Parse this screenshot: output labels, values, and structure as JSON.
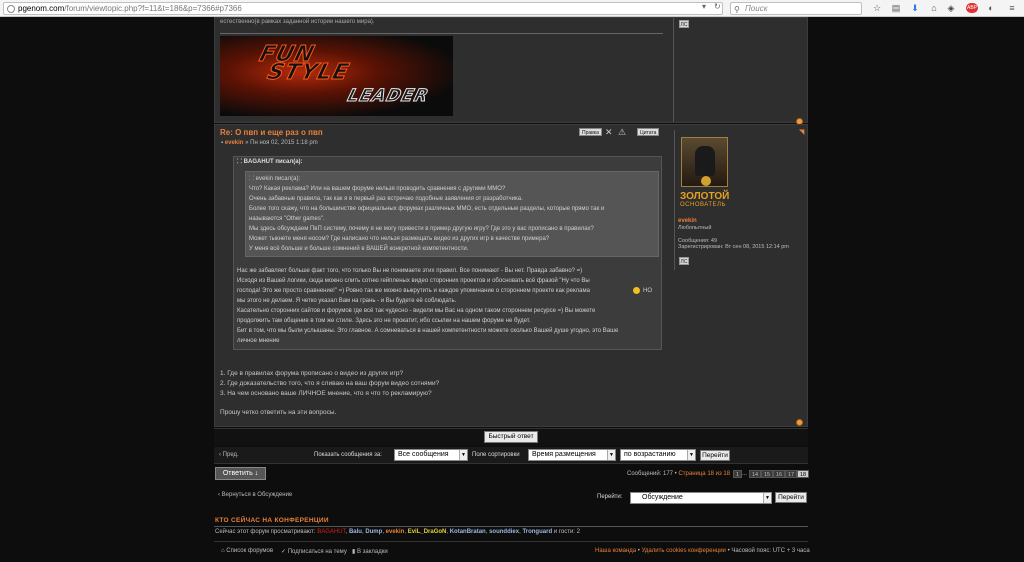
{
  "browser": {
    "url_domain": "pgenom.com",
    "url_path": "/forum/viewtopic.php?f=11&t=186&p=7366#p7366",
    "search_placeholder": "Поиск"
  },
  "prev_post": {
    "text_top": "естественно(в рамках заданной истории нашего мира).",
    "logo_line1": "FUN",
    "logo_line2": "STYLE",
    "logo_line3": "LEADER",
    "ps_label": "ЛС"
  },
  "post": {
    "title": "Re: О пвп и еще раз о пвп",
    "author": "evekin",
    "date": "Пн ноя 02, 2015 1:18 pm",
    "actions": {
      "edit": "Правка",
      "quote": "Цитата"
    },
    "outer_quote_head": "BAGAHUT писал(а):",
    "inner_quote_head": "evekin писал(а):",
    "inner_quote_lines": [
      "Что? Какая реклама? Или на вашем форуме нельзя проводить сравнения с другими ММО?",
      "Очень забавные правила, так как я в первый раз встречаю подобные заявления от разработчика.",
      "Более того скажу, что на большинстве официальных форумах различных ММО, есть отдельные разделы, которые прямо так и",
      "называются \"Other games\".",
      "Мы здесь обсуждаем ПвП систему, почему я не могу привести в пример другую игру? Где это у вас прописано в правилах?",
      "Может тыкнете меня носом? Где написано что нельзя размещать видео из других игр в качестве примера?",
      "У меня всё больше и больше сомнений в ВАШЕЙ конкретной компетентности."
    ],
    "outer_quote_lines": [
      "Нас же забавляет больше факт того, что только Вы не понимаете этих правил. Все понимают - Вы нет. Правда забавно? =)",
      "Исходя из Вашей логики, сюда можно слить сотню гейпленых видео сторонних проектов и обосновать всё фразой \"Ну что Вы",
      "господа! Это же просто сравнение!\" =) Ровно так же можно выкрутить и каждое упоминание о стороннем проекте как реклама",
      "НО",
      "мы этого не делаем. Я четко указал Вам на грань - и Вы будете её соблюдать.",
      "Касательно сторонних сайтов и форумов где всё так чудесно - видели мы Вас на одном таком стороннем ресурсе =) Вы можете",
      "продолжить там общение в том же стиле. Здесь это не прокатит, ибо ссылки на нашем форуме не будет.",
      "Бит в том, что мы были услышаны. Это главное. А сомневаться в нашей компетентности можете сколько Вашей душе угодно, это Ваше",
      "личное мнение"
    ],
    "body_lines": [
      "1. Где в правилах форума прописано о видео из других игр?",
      "2. Где доказательство того, что я сливаю на ваш форум видео сотнями?",
      "3. На чем основано ваше ЛИЧНОЕ мнение, что я что то рекламирую?"
    ],
    "closing": "Прошу четко ответить на эти вопросы."
  },
  "profile": {
    "rank_line1": "ЗОЛОТОЙ",
    "rank_line2": "ОСНОВАТЕЛЬ",
    "name": "evekin",
    "title": "Любопытный",
    "messages": "Сообщения: 49",
    "registered": "Зарегистрирован: Вт сен 08, 2015 12:14 pm",
    "ps_label": "ЛС"
  },
  "quick_reply": {
    "label": "Быстрый ответ"
  },
  "nav": {
    "prev": "Пред.",
    "show_label": "Показать сообщения за:",
    "show_value": "Все сообщения",
    "sort_label": "Поле сортировки",
    "sort_value": "Время размещения",
    "order_value": "по возрастанию",
    "go": "Перейти"
  },
  "pagination": {
    "reply": "Ответить",
    "summary": "Сообщений: 177",
    "page_info": "Страница 18 из 18",
    "pages": [
      "1",
      "...",
      "14",
      "15",
      "16",
      "17",
      "18"
    ]
  },
  "return_link": "Вернуться в Обсуждение",
  "jump": {
    "label": "Перейти:",
    "value": "Обсуждение",
    "go": "Перейти"
  },
  "who": {
    "heading": "КТО СЕЙЧАС НА КОНФЕРЕНЦИИ",
    "prefix": "Сейчас этот форум просматривают:",
    "users": [
      "BAGAHUT",
      "Balu",
      "Dump",
      "evekin",
      "EviL_DraGoN",
      "KotanBratan",
      "sounddiex",
      "Tronguard"
    ],
    "suffix": "и гости: 2"
  },
  "footer": {
    "forum_list": "Список форумов",
    "subscribe": "Подписаться на тему",
    "bookmarks": "В закладки",
    "team": "Наша команда",
    "delete_cookies": "Удалить cookies конференции",
    "tz": "Часовой пояс: UTC + 3 часа"
  }
}
